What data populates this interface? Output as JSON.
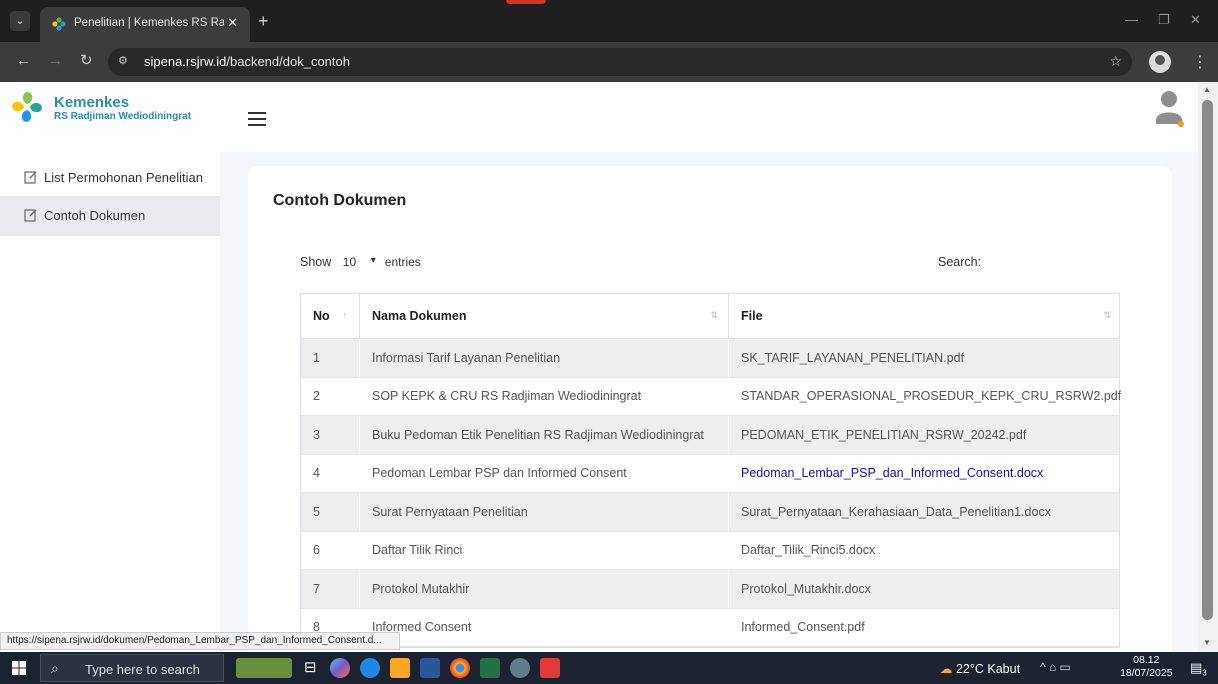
{
  "browser": {
    "tab_title": "Penelitian | Kemenkes RS Radjiman Wediodiningrat",
    "tab_close": "✕",
    "new_tab": "+",
    "url_host": "sipena.rsjrw.id",
    "url_path": "/backend/dok_contoh"
  },
  "header": {
    "logo_title": "Kemenkes",
    "logo_subtitle": "RS Radjiman Wediodiningrat"
  },
  "sidebar": {
    "items": [
      {
        "label": "List Permohonan Penelitian"
      },
      {
        "label": "Contoh Dokumen"
      }
    ]
  },
  "main": {
    "title": "Contoh Dokumen",
    "show_label": "Show",
    "page_length": "10",
    "entries_label": "entries",
    "search_label": "Search:",
    "columns": [
      "No",
      "Nama Dokumen",
      "File"
    ],
    "rows": [
      {
        "no": "1",
        "name": "Informasi Tarif Layanan Penelitian",
        "file": "SK_TARIF_LAYANAN_PENELITIAN.pdf"
      },
      {
        "no": "2",
        "name": "SOP KEPK & CRU RS Radjiman Wediodiningrat",
        "file": "STANDAR_OPERASIONAL_PROSEDUR_KEPK_CRU_RSRW2.pdf"
      },
      {
        "no": "3",
        "name": "Buku Pedoman Etik Penelitian RS Radjiman Wediodiningrat",
        "file": "PEDOMAN_ETIK_PENELITIAN_RSRW_20242.pdf"
      },
      {
        "no": "4",
        "name": "Pedoman Lembar PSP dan Informed Consent",
        "file": "Pedoman_Lembar_PSP_dan_Informed_Consent.docx"
      },
      {
        "no": "5",
        "name": "Surat Pernyataan Penelitian",
        "file": "Surat_Pernyataan_Kerahasiaan_Data_Penelitian1.docx"
      },
      {
        "no": "6",
        "name": "Daftar Tilik Rinci",
        "file": "Daftar_Tilik_Rinci5.docx"
      },
      {
        "no": "7",
        "name": "Protokol Mutakhir",
        "file": "Protokol_Mutakhir.docx"
      },
      {
        "no": "8",
        "name": "Informed Consent",
        "file": "Informed_Consent.pdf"
      }
    ]
  },
  "status_bar": {
    "hover_url": "https://sipena.rsjrw.id/dokumen/Pedoman_Lembar_PSP_dan_Informed_Consent.d..."
  },
  "taskbar": {
    "search_placeholder": "Type here to search",
    "weather": "22°C  Kabut",
    "time": "08.12",
    "date": "18/07/2025",
    "notification_count": "3"
  },
  "colors": {
    "brand": "#2a8ea6",
    "link": "#1a0dab",
    "row_stripe": "#eeeeee"
  }
}
